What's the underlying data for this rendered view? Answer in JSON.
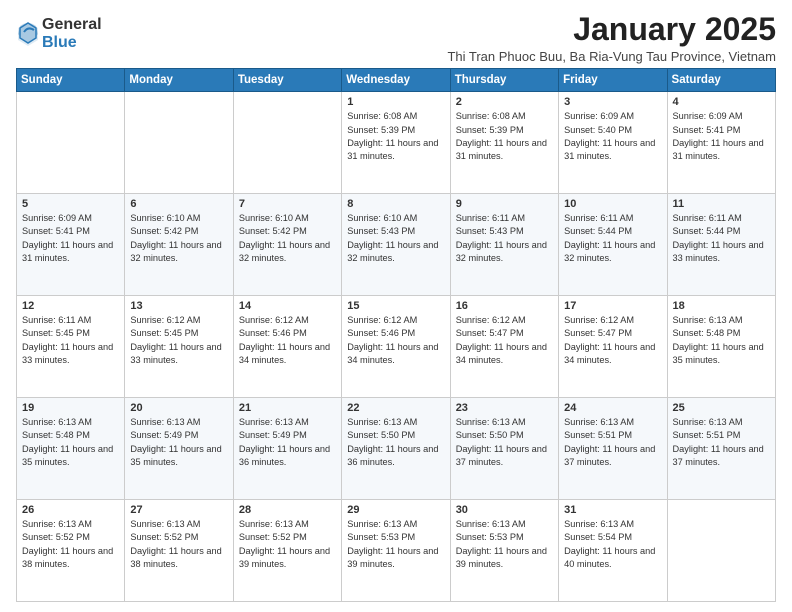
{
  "logo": {
    "general": "General",
    "blue": "Blue"
  },
  "header": {
    "month": "January 2025",
    "location": "Thi Tran Phuoc Buu, Ba Ria-Vung Tau Province, Vietnam"
  },
  "days_of_week": [
    "Sunday",
    "Monday",
    "Tuesday",
    "Wednesday",
    "Thursday",
    "Friday",
    "Saturday"
  ],
  "weeks": [
    [
      {
        "day": "",
        "sunrise": "",
        "sunset": "",
        "daylight": ""
      },
      {
        "day": "",
        "sunrise": "",
        "sunset": "",
        "daylight": ""
      },
      {
        "day": "",
        "sunrise": "",
        "sunset": "",
        "daylight": ""
      },
      {
        "day": "1",
        "sunrise": "Sunrise: 6:08 AM",
        "sunset": "Sunset: 5:39 PM",
        "daylight": "Daylight: 11 hours and 31 minutes."
      },
      {
        "day": "2",
        "sunrise": "Sunrise: 6:08 AM",
        "sunset": "Sunset: 5:39 PM",
        "daylight": "Daylight: 11 hours and 31 minutes."
      },
      {
        "day": "3",
        "sunrise": "Sunrise: 6:09 AM",
        "sunset": "Sunset: 5:40 PM",
        "daylight": "Daylight: 11 hours and 31 minutes."
      },
      {
        "day": "4",
        "sunrise": "Sunrise: 6:09 AM",
        "sunset": "Sunset: 5:41 PM",
        "daylight": "Daylight: 11 hours and 31 minutes."
      }
    ],
    [
      {
        "day": "5",
        "sunrise": "Sunrise: 6:09 AM",
        "sunset": "Sunset: 5:41 PM",
        "daylight": "Daylight: 11 hours and 31 minutes."
      },
      {
        "day": "6",
        "sunrise": "Sunrise: 6:10 AM",
        "sunset": "Sunset: 5:42 PM",
        "daylight": "Daylight: 11 hours and 32 minutes."
      },
      {
        "day": "7",
        "sunrise": "Sunrise: 6:10 AM",
        "sunset": "Sunset: 5:42 PM",
        "daylight": "Daylight: 11 hours and 32 minutes."
      },
      {
        "day": "8",
        "sunrise": "Sunrise: 6:10 AM",
        "sunset": "Sunset: 5:43 PM",
        "daylight": "Daylight: 11 hours and 32 minutes."
      },
      {
        "day": "9",
        "sunrise": "Sunrise: 6:11 AM",
        "sunset": "Sunset: 5:43 PM",
        "daylight": "Daylight: 11 hours and 32 minutes."
      },
      {
        "day": "10",
        "sunrise": "Sunrise: 6:11 AM",
        "sunset": "Sunset: 5:44 PM",
        "daylight": "Daylight: 11 hours and 32 minutes."
      },
      {
        "day": "11",
        "sunrise": "Sunrise: 6:11 AM",
        "sunset": "Sunset: 5:44 PM",
        "daylight": "Daylight: 11 hours and 33 minutes."
      }
    ],
    [
      {
        "day": "12",
        "sunrise": "Sunrise: 6:11 AM",
        "sunset": "Sunset: 5:45 PM",
        "daylight": "Daylight: 11 hours and 33 minutes."
      },
      {
        "day": "13",
        "sunrise": "Sunrise: 6:12 AM",
        "sunset": "Sunset: 5:45 PM",
        "daylight": "Daylight: 11 hours and 33 minutes."
      },
      {
        "day": "14",
        "sunrise": "Sunrise: 6:12 AM",
        "sunset": "Sunset: 5:46 PM",
        "daylight": "Daylight: 11 hours and 34 minutes."
      },
      {
        "day": "15",
        "sunrise": "Sunrise: 6:12 AM",
        "sunset": "Sunset: 5:46 PM",
        "daylight": "Daylight: 11 hours and 34 minutes."
      },
      {
        "day": "16",
        "sunrise": "Sunrise: 6:12 AM",
        "sunset": "Sunset: 5:47 PM",
        "daylight": "Daylight: 11 hours and 34 minutes."
      },
      {
        "day": "17",
        "sunrise": "Sunrise: 6:12 AM",
        "sunset": "Sunset: 5:47 PM",
        "daylight": "Daylight: 11 hours and 34 minutes."
      },
      {
        "day": "18",
        "sunrise": "Sunrise: 6:13 AM",
        "sunset": "Sunset: 5:48 PM",
        "daylight": "Daylight: 11 hours and 35 minutes."
      }
    ],
    [
      {
        "day": "19",
        "sunrise": "Sunrise: 6:13 AM",
        "sunset": "Sunset: 5:48 PM",
        "daylight": "Daylight: 11 hours and 35 minutes."
      },
      {
        "day": "20",
        "sunrise": "Sunrise: 6:13 AM",
        "sunset": "Sunset: 5:49 PM",
        "daylight": "Daylight: 11 hours and 35 minutes."
      },
      {
        "day": "21",
        "sunrise": "Sunrise: 6:13 AM",
        "sunset": "Sunset: 5:49 PM",
        "daylight": "Daylight: 11 hours and 36 minutes."
      },
      {
        "day": "22",
        "sunrise": "Sunrise: 6:13 AM",
        "sunset": "Sunset: 5:50 PM",
        "daylight": "Daylight: 11 hours and 36 minutes."
      },
      {
        "day": "23",
        "sunrise": "Sunrise: 6:13 AM",
        "sunset": "Sunset: 5:50 PM",
        "daylight": "Daylight: 11 hours and 37 minutes."
      },
      {
        "day": "24",
        "sunrise": "Sunrise: 6:13 AM",
        "sunset": "Sunset: 5:51 PM",
        "daylight": "Daylight: 11 hours and 37 minutes."
      },
      {
        "day": "25",
        "sunrise": "Sunrise: 6:13 AM",
        "sunset": "Sunset: 5:51 PM",
        "daylight": "Daylight: 11 hours and 37 minutes."
      }
    ],
    [
      {
        "day": "26",
        "sunrise": "Sunrise: 6:13 AM",
        "sunset": "Sunset: 5:52 PM",
        "daylight": "Daylight: 11 hours and 38 minutes."
      },
      {
        "day": "27",
        "sunrise": "Sunrise: 6:13 AM",
        "sunset": "Sunset: 5:52 PM",
        "daylight": "Daylight: 11 hours and 38 minutes."
      },
      {
        "day": "28",
        "sunrise": "Sunrise: 6:13 AM",
        "sunset": "Sunset: 5:52 PM",
        "daylight": "Daylight: 11 hours and 39 minutes."
      },
      {
        "day": "29",
        "sunrise": "Sunrise: 6:13 AM",
        "sunset": "Sunset: 5:53 PM",
        "daylight": "Daylight: 11 hours and 39 minutes."
      },
      {
        "day": "30",
        "sunrise": "Sunrise: 6:13 AM",
        "sunset": "Sunset: 5:53 PM",
        "daylight": "Daylight: 11 hours and 39 minutes."
      },
      {
        "day": "31",
        "sunrise": "Sunrise: 6:13 AM",
        "sunset": "Sunset: 5:54 PM",
        "daylight": "Daylight: 11 hours and 40 minutes."
      },
      {
        "day": "",
        "sunrise": "",
        "sunset": "",
        "daylight": ""
      }
    ]
  ]
}
